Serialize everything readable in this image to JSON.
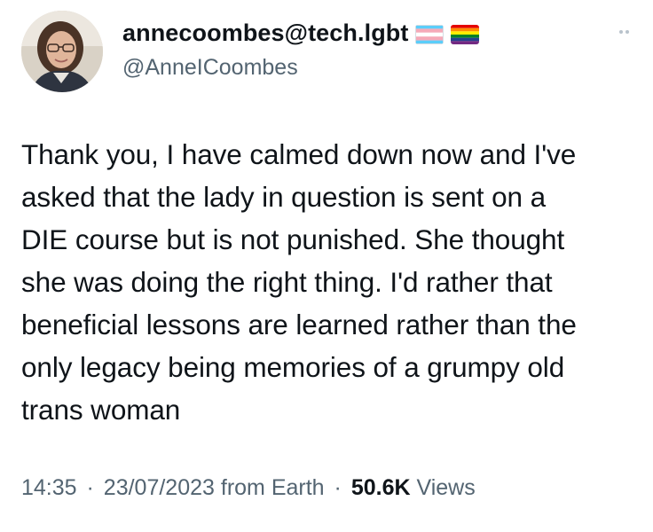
{
  "author": {
    "display_name": "annecoombes@tech.lgbt",
    "handle": "@AnneICoombes",
    "flags": [
      "transgender-flag-icon",
      "rainbow-pride-flag-icon"
    ]
  },
  "tweet": {
    "text": "Thank you, I have calmed down now and I've\nasked that the lady in question is sent on a\nDIE course but is not punished. She thought\nshe was doing the right thing. I'd rather that\nbeneficial lessons are learned rather than the\nonly legacy being memories of a grumpy old\ntrans woman"
  },
  "meta": {
    "time": "14:35",
    "separator": "·",
    "date": "23/07/2023",
    "source": "from Earth",
    "views_count": "50.6K",
    "views_label": "Views"
  },
  "colors": {
    "text_primary": "#0f1419",
    "text_secondary": "#536471",
    "trans_blue": "#5BCEFA",
    "trans_pink": "#F5A9B8",
    "trans_white": "#FFFFFF"
  },
  "icons": {
    "more": "more-options-icon"
  }
}
